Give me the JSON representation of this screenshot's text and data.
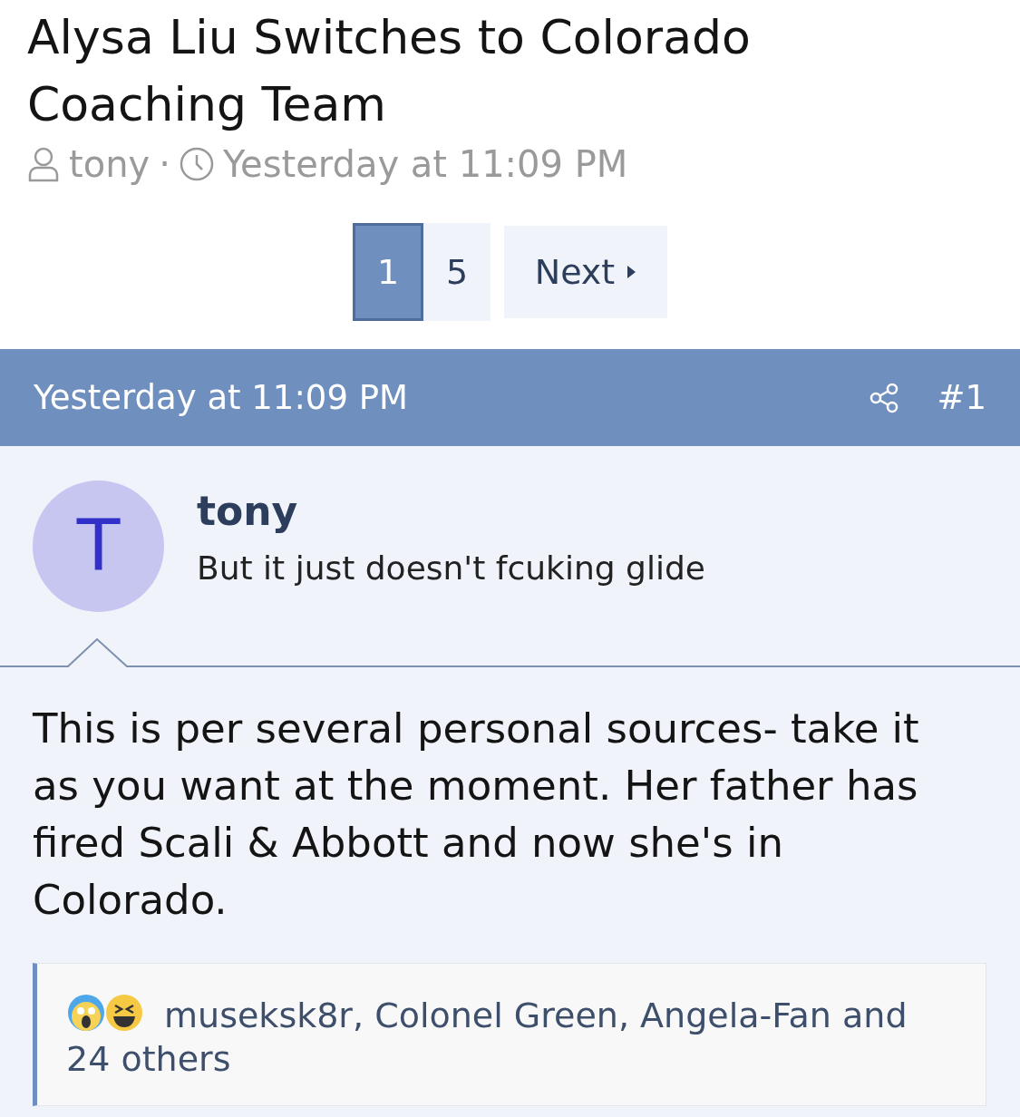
{
  "thread": {
    "title": "Alysa Liu Switches to Colorado Coaching Team",
    "author": "tony",
    "separator": "·",
    "date": "Yesterday at 11:09 PM"
  },
  "pagination": {
    "pages": [
      {
        "label": "1",
        "selected": true
      },
      {
        "label": "5",
        "selected": false
      }
    ],
    "next": "Next"
  },
  "post": {
    "date": "Yesterday at 11:09 PM",
    "number": "#1",
    "avatar_letter": "T",
    "author": "tony",
    "signature": "But it just doesn't fcuking glide",
    "body": "This is per several personal sources- take it as you want at the moment. Her father has fired Scali & Abbott and now she's in Colorado.",
    "reactions": {
      "text": "museksk8r, Colonel Green, Angela-Fan and 24 others"
    }
  }
}
